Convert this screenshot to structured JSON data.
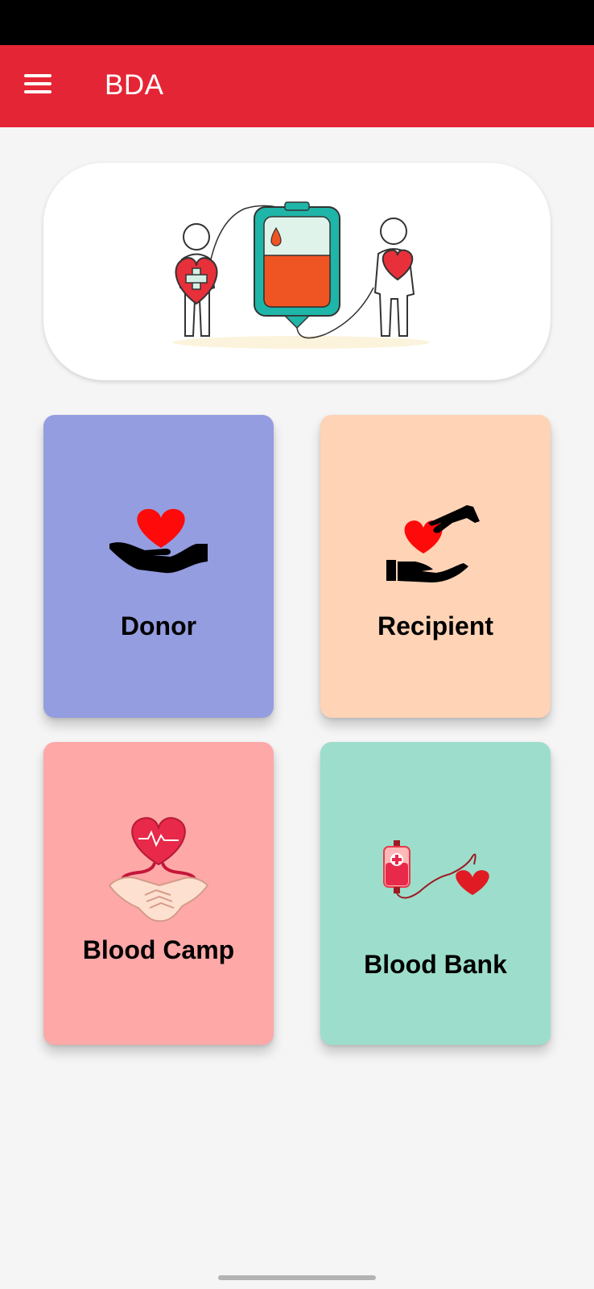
{
  "app_bar": {
    "title": "BDA",
    "menu_icon": "hamburger-menu-icon",
    "background": "#e42535"
  },
  "hero": {
    "illustration": "blood-donation-illustration"
  },
  "cards": [
    {
      "id": "donor",
      "label": "Donor",
      "icon": "heart-in-hand-icon",
      "background": "#949ddf"
    },
    {
      "id": "recipient",
      "label": "Recipient",
      "icon": "heart-handover-icon",
      "background": "#fed3b6"
    },
    {
      "id": "camp",
      "label": "Blood Camp",
      "icon": "heart-handshake-icon",
      "background": "#fea8a8"
    },
    {
      "id": "bank",
      "label": "Blood Bank",
      "icon": "blood-bag-heart-icon",
      "background": "#9cdecb"
    }
  ]
}
